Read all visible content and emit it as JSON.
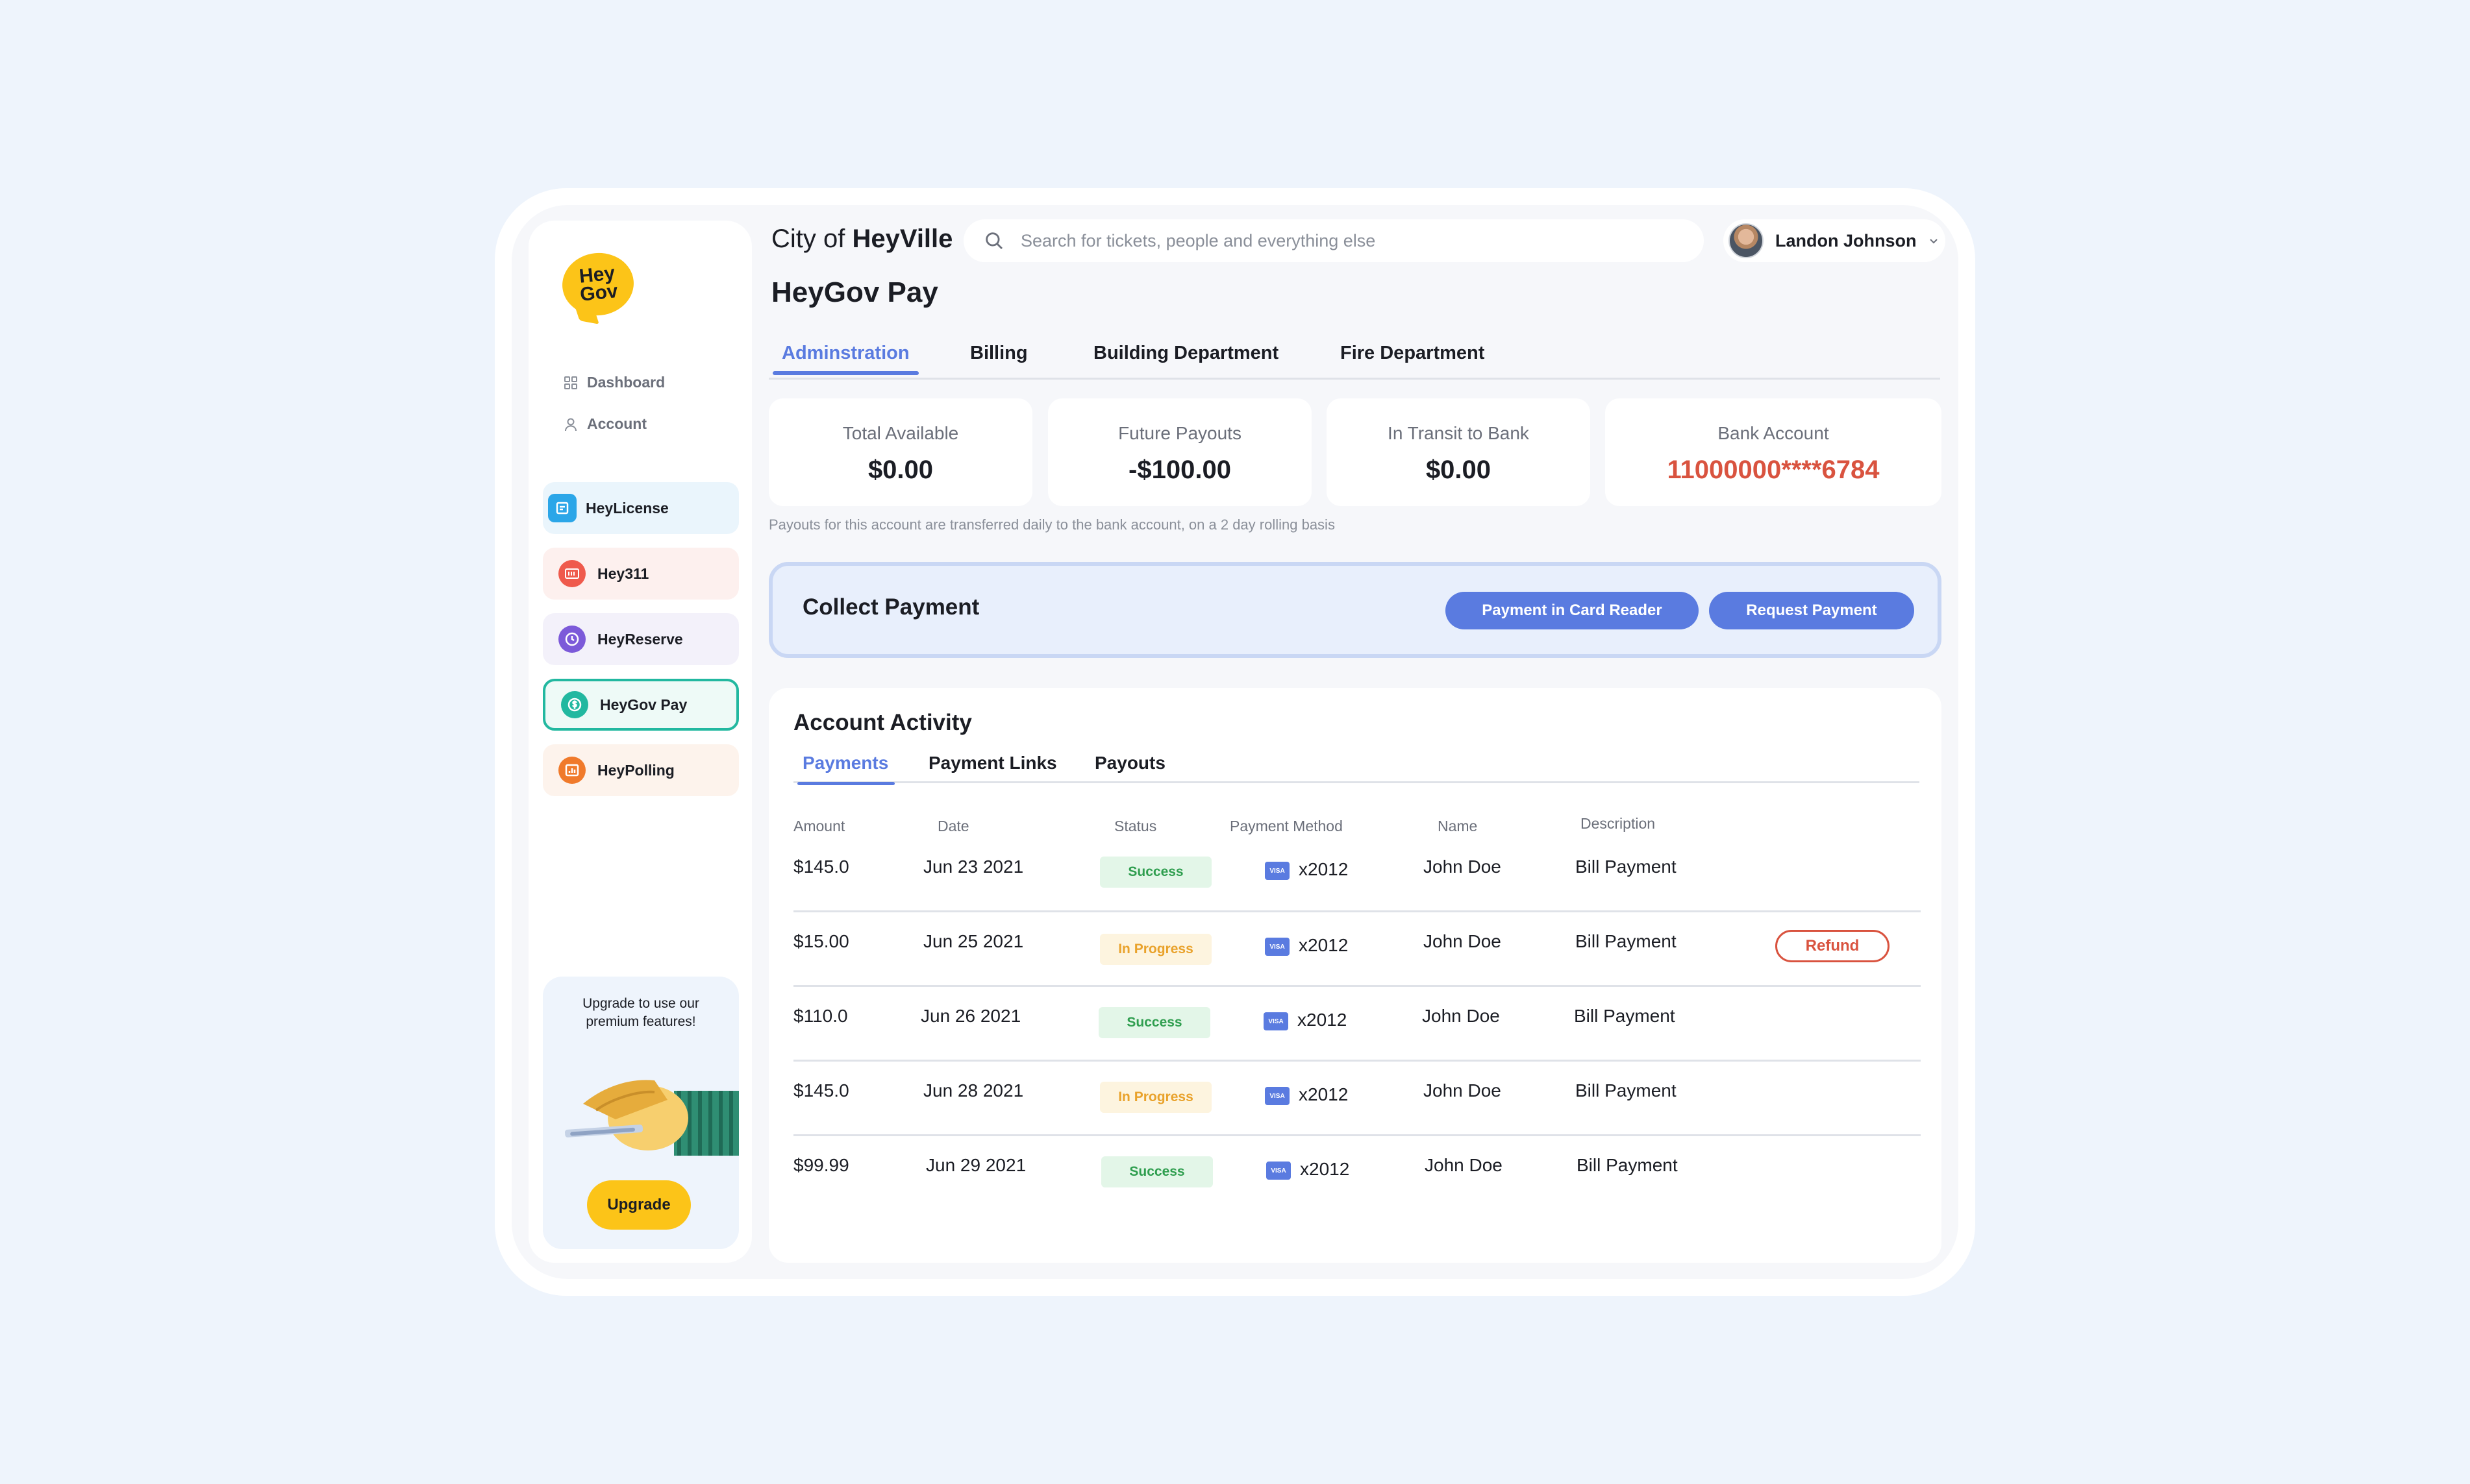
{
  "brand": {
    "logo_line1": "Hey",
    "logo_line2": "Gov"
  },
  "sidebar": {
    "links": [
      {
        "label": "Dashboard"
      },
      {
        "label": "Account"
      }
    ],
    "apps": [
      {
        "label": "HeyLicense",
        "color": "#2ba6e8",
        "bg": "#eaf5fc"
      },
      {
        "label": "Hey311",
        "color": "#ef5a4c",
        "bg": "#fdf0ee"
      },
      {
        "label": "HeyReserve",
        "color": "#7c5ad9",
        "bg": "#f3f1fa"
      },
      {
        "label": "HeyGov Pay",
        "color": "#22b8a0",
        "bg": "#eefaf7"
      },
      {
        "label": "HeyPolling",
        "color": "#f07a2b",
        "bg": "#fdf3ec"
      }
    ],
    "promo": {
      "text": "Upgrade to use our premium features!",
      "button": "Upgrade"
    }
  },
  "topbar": {
    "city_prefix": "City of",
    "city_name": "HeyVille",
    "search_placeholder": "Search for tickets, people and everything else",
    "user_name": "Landon Johnson"
  },
  "page": {
    "title": "HeyGov Pay"
  },
  "tabs": [
    {
      "label": "Adminstration",
      "active": true
    },
    {
      "label": "Billing"
    },
    {
      "label": "Building Department"
    },
    {
      "label": "Fire Department"
    }
  ],
  "stats": [
    {
      "label": "Total Available",
      "value": "$0.00"
    },
    {
      "label": "Future Payouts",
      "value": "-$100.00"
    },
    {
      "label": "In Transit to Bank",
      "value": "$0.00"
    },
    {
      "label": "Bank Account",
      "value": "11000000****6784",
      "color": "#d9533f"
    }
  ],
  "payout_note": "Payouts for this account are transferred daily to the bank account, on a 2 day rolling basis",
  "collect": {
    "title": "Collect Payment",
    "card_reader_button": "Payment in Card Reader",
    "request_button": "Request Payment"
  },
  "activity": {
    "title": "Account Activity",
    "subtabs": [
      {
        "label": "Payments",
        "active": true
      },
      {
        "label": "Payment Links"
      },
      {
        "label": "Payouts"
      }
    ],
    "columns": [
      "Amount",
      "Date",
      "Status",
      "Payment Method",
      "Name",
      "Description"
    ],
    "card_brand": "VISA",
    "rows": [
      {
        "amount": "$145.0",
        "date": "Jun 23 2021",
        "status": "Success",
        "method": "x2012",
        "name": "John Doe",
        "description": "Bill Payment"
      },
      {
        "amount": "$15.00",
        "date": "Jun 25 2021",
        "status": "In Progress",
        "method": "x2012",
        "name": "John Doe",
        "description": "Bill Payment",
        "action": "Refund"
      },
      {
        "amount": "$110.0",
        "date": "Jun 26 2021",
        "status": "Success",
        "method": "x2012",
        "name": "John Doe",
        "description": "Bill Payment"
      },
      {
        "amount": "$145.0",
        "date": "Jun 28 2021",
        "status": "In Progress",
        "method": "x2012",
        "name": "John Doe",
        "description": "Bill Payment"
      },
      {
        "amount": "$99.99",
        "date": "Jun 29 2021",
        "status": "Success",
        "method": "x2012",
        "name": "John Doe",
        "description": "Bill Payment"
      }
    ]
  },
  "colors": {
    "accent": "#5a7be0",
    "brand_yellow": "#fcc418",
    "danger": "#d9533f",
    "page_bg": "#eef4fc"
  }
}
